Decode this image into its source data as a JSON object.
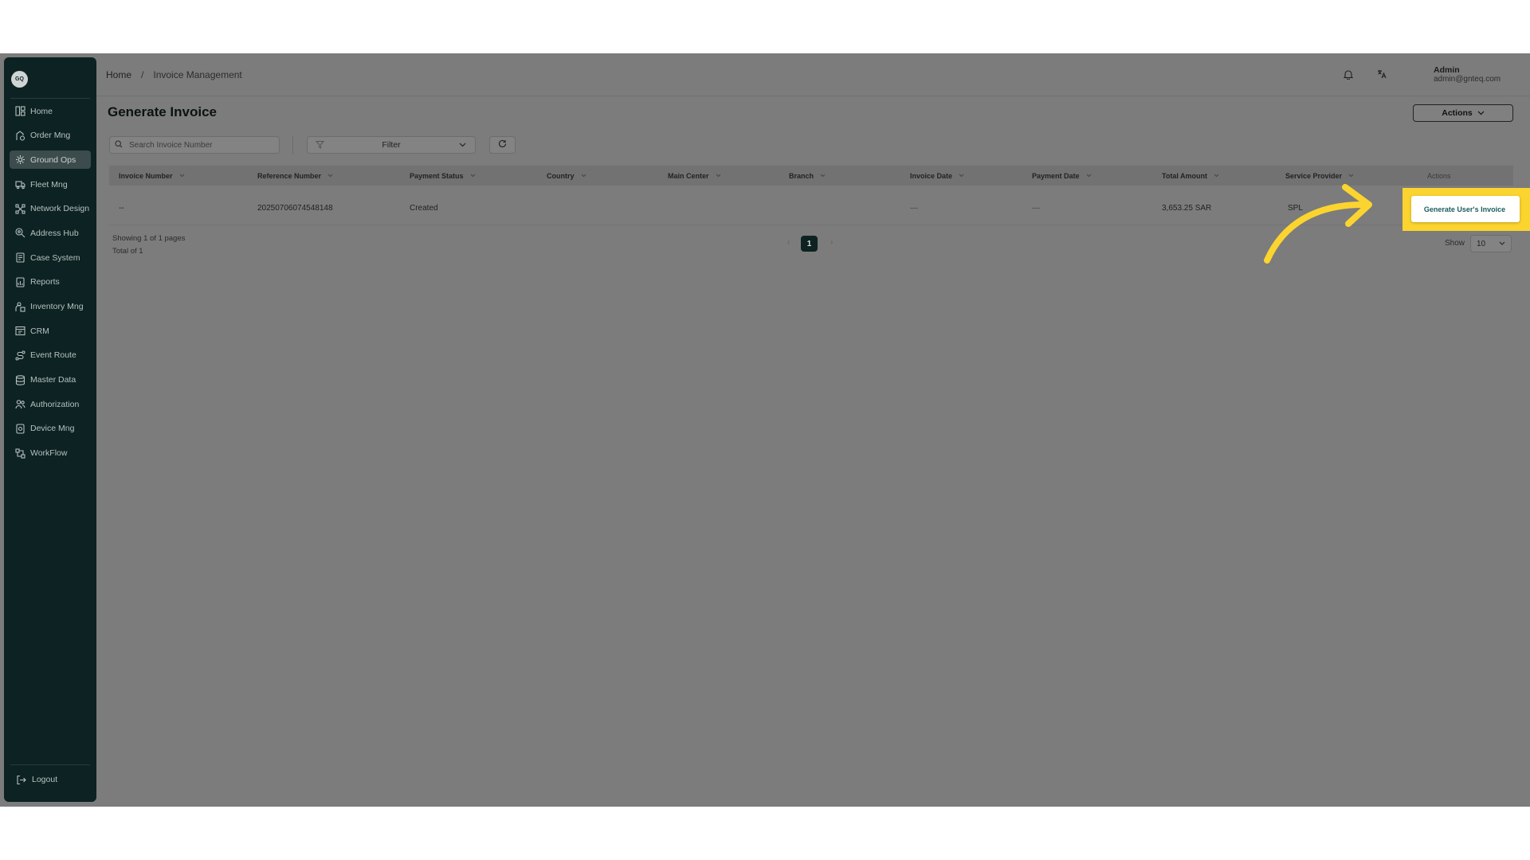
{
  "sidebar": {
    "logo_text": "GQ",
    "items": [
      {
        "label": "Home",
        "icon": "home-icon"
      },
      {
        "label": "Order Mng",
        "icon": "order-icon"
      },
      {
        "label": "Ground Ops",
        "icon": "ground-ops-icon",
        "active": true
      },
      {
        "label": "Fleet Mng",
        "icon": "truck-icon"
      },
      {
        "label": "Network Design",
        "icon": "network-icon"
      },
      {
        "label": "Address Hub",
        "icon": "location-icon"
      },
      {
        "label": "Case System",
        "icon": "case-icon"
      },
      {
        "label": "Reports",
        "icon": "report-icon"
      },
      {
        "label": "Inventory Mng",
        "icon": "inventory-icon"
      },
      {
        "label": "CRM",
        "icon": "crm-icon"
      },
      {
        "label": "Event Route",
        "icon": "route-icon"
      },
      {
        "label": "Master Data",
        "icon": "database-icon"
      },
      {
        "label": "Authorization",
        "icon": "users-icon"
      },
      {
        "label": "Device Mng",
        "icon": "device-icon"
      },
      {
        "label": "WorkFlow",
        "icon": "workflow-icon"
      }
    ],
    "logout_label": "Logout"
  },
  "header": {
    "breadcrumb_home": "Home",
    "breadcrumb_sep": "/",
    "breadcrumb_current": "Invoice Management",
    "user_name": "Admin",
    "user_email": "admin@gnteq.com"
  },
  "page": {
    "title": "Generate Invoice",
    "actions_label": "Actions"
  },
  "toolbar": {
    "search_placeholder": "Search Invoice Number",
    "filter_label": "Filter"
  },
  "table": {
    "columns": [
      "Invoice Number",
      "Reference Number",
      "Payment Status",
      "Country",
      "Main Center",
      "Branch",
      "Invoice Date",
      "Payment Date",
      "Total Amount",
      "Service Provider",
      "Actions"
    ],
    "rows": [
      {
        "invoice_number": "--",
        "reference_number": "20250706074548148",
        "payment_status": "Created",
        "country": "",
        "main_center": "",
        "branch": "",
        "invoice_date": "—",
        "payment_date": "—",
        "total_amount": "3,653.25 SAR",
        "service_provider": "SPL"
      }
    ]
  },
  "pagination": {
    "showing_text": "Showing 1 of 1 pages",
    "total_text": "Total of 1",
    "prev": "‹",
    "next": "›",
    "current_page": "1",
    "show_label": "Show",
    "page_size": "10"
  },
  "dropdown": {
    "generate_users_invoice": "Generate User's Invoice"
  },
  "colors": {
    "highlight": "#fbd42f",
    "sidebar_bg": "#0d2222",
    "overlay_bg": "#7b7c7b"
  }
}
